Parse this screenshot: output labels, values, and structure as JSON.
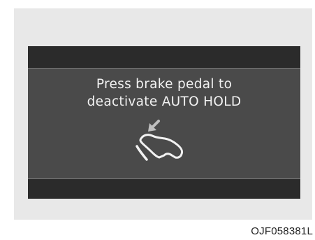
{
  "display": {
    "message_line1": "Press brake pedal to",
    "message_line2": "deactivate AUTO HOLD",
    "icon": "brake-pedal-press-icon"
  },
  "caption": "OJF058381L",
  "colors": {
    "panel_background": "#e8e8e8",
    "display_background": "#4a4a4a",
    "display_bars": "#2b2b2b",
    "text": "#f2f2f2"
  }
}
